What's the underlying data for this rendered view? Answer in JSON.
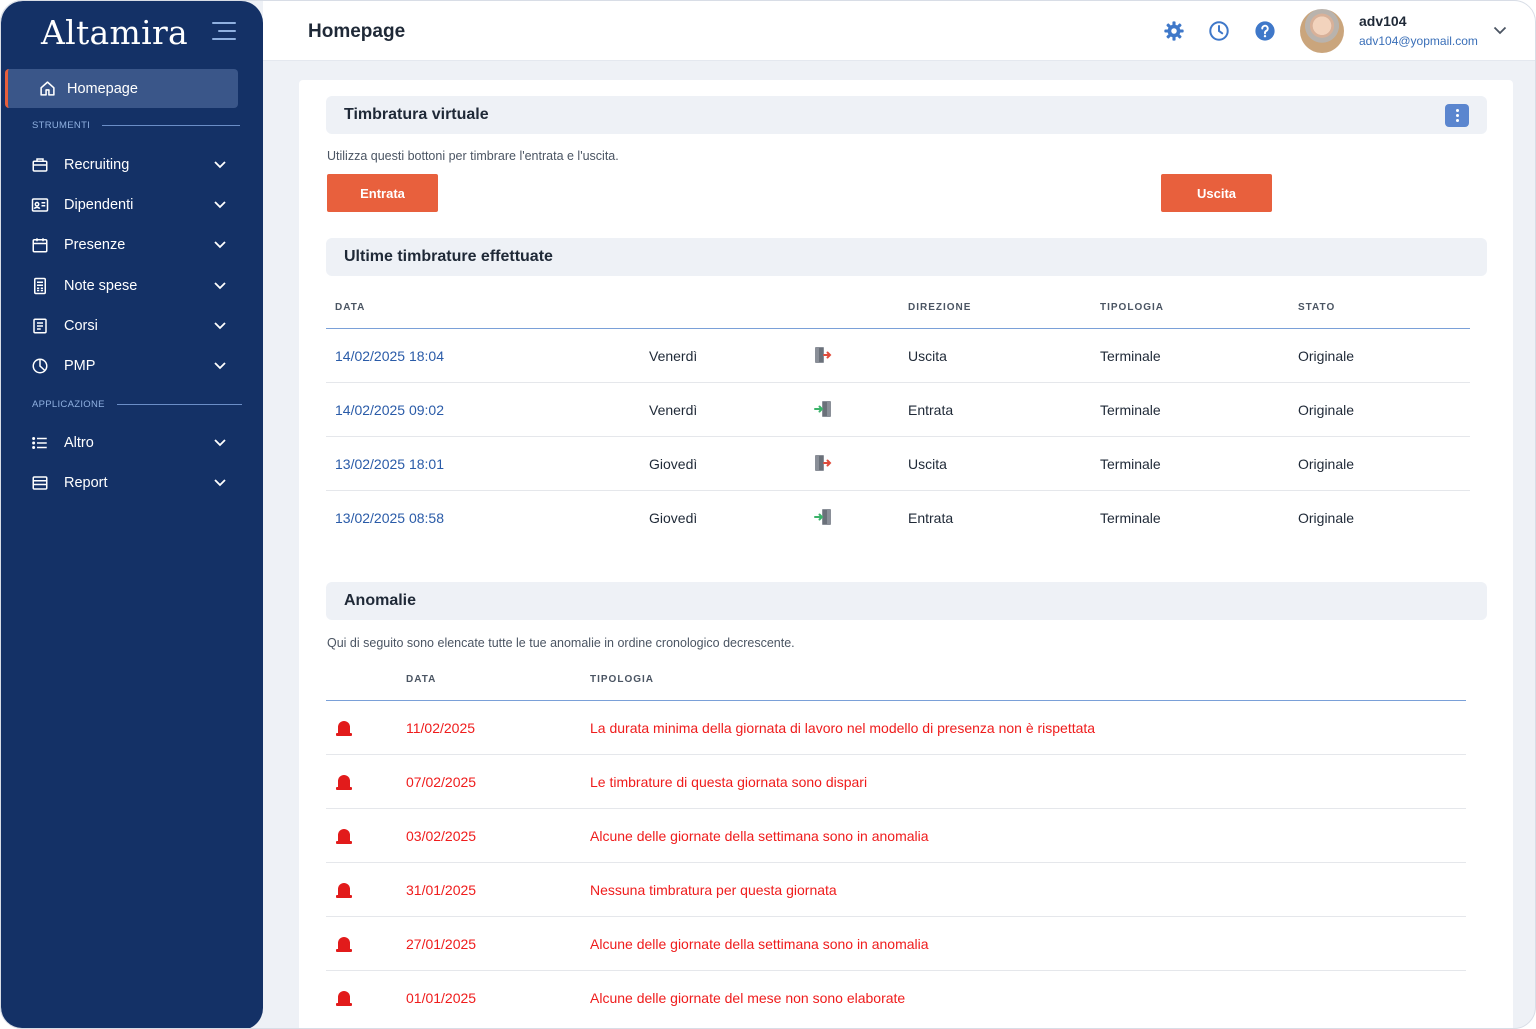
{
  "app": {
    "logo": "Altamira"
  },
  "sidebar": {
    "home_label": "Homepage",
    "section_tools": "STRUMENTI",
    "section_apps": "APPLICAZIONE",
    "tools": [
      {
        "label": "Recruiting",
        "icon": "briefcase-icon"
      },
      {
        "label": "Dipendenti",
        "icon": "id-card-icon"
      },
      {
        "label": "Presenze",
        "icon": "calendar-icon"
      },
      {
        "label": "Note spese",
        "icon": "receipt-icon"
      },
      {
        "label": "Corsi",
        "icon": "document-icon"
      },
      {
        "label": "PMP",
        "icon": "pie-chart-icon"
      }
    ],
    "apps": [
      {
        "label": "Altro",
        "icon": "list-icon"
      },
      {
        "label": "Report",
        "icon": "report-icon"
      }
    ]
  },
  "header": {
    "title": "Homepage",
    "user_name": "adv104",
    "user_email": "adv104@yopmail.com"
  },
  "timbratura": {
    "title": "Timbratura virtuale",
    "description": "Utilizza questi bottoni per timbrare l'entrata e l'uscita.",
    "btn_entrata": "Entrata",
    "btn_uscita": "Uscita"
  },
  "ultime": {
    "title": "Ultime timbrature effettuate",
    "columns": {
      "data": "DATA",
      "direzione": "DIREZIONE",
      "tipologia": "TIPOLOGIA",
      "stato": "STATO"
    },
    "rows": [
      {
        "date": "14/02/2025 18:04",
        "day": "Venerdì",
        "icon": "exit-door-icon",
        "direction": "Uscita",
        "type": "Terminale",
        "state": "Originale"
      },
      {
        "date": "14/02/2025 09:02",
        "day": "Venerdì",
        "icon": "enter-door-icon",
        "direction": "Entrata",
        "type": "Terminale",
        "state": "Originale"
      },
      {
        "date": "13/02/2025 18:01",
        "day": "Giovedì",
        "icon": "exit-door-icon",
        "direction": "Uscita",
        "type": "Terminale",
        "state": "Originale"
      },
      {
        "date": "13/02/2025 08:58",
        "day": "Giovedì",
        "icon": "enter-door-icon",
        "direction": "Entrata",
        "type": "Terminale",
        "state": "Originale"
      }
    ]
  },
  "anomalie": {
    "title": "Anomalie",
    "description": "Qui di seguito sono elencate tutte le tue anomalie in ordine cronologico decrescente.",
    "columns": {
      "data": "DATA",
      "tipologia": "TIPOLOGIA"
    },
    "rows": [
      {
        "date": "11/02/2025",
        "text": "La durata minima della giornata di lavoro nel modello di presenza non è rispettata"
      },
      {
        "date": "07/02/2025",
        "text": "Le timbrature di questa giornata sono dispari"
      },
      {
        "date": "03/02/2025",
        "text": "Alcune delle giornate della settimana sono in anomalia"
      },
      {
        "date": "31/01/2025",
        "text": "Nessuna timbratura per questa giornata"
      },
      {
        "date": "27/01/2025",
        "text": "Alcune delle giornate della settimana sono in anomalia"
      },
      {
        "date": "01/01/2025",
        "text": "Alcune delle giornate del mese non sono elaborate"
      }
    ]
  },
  "colors": {
    "sidebar": "#143166",
    "accent": "#e8603d",
    "link": "#2a5ba8",
    "alert": "#ef1c1c",
    "icon_blue": "#3f78c9"
  }
}
